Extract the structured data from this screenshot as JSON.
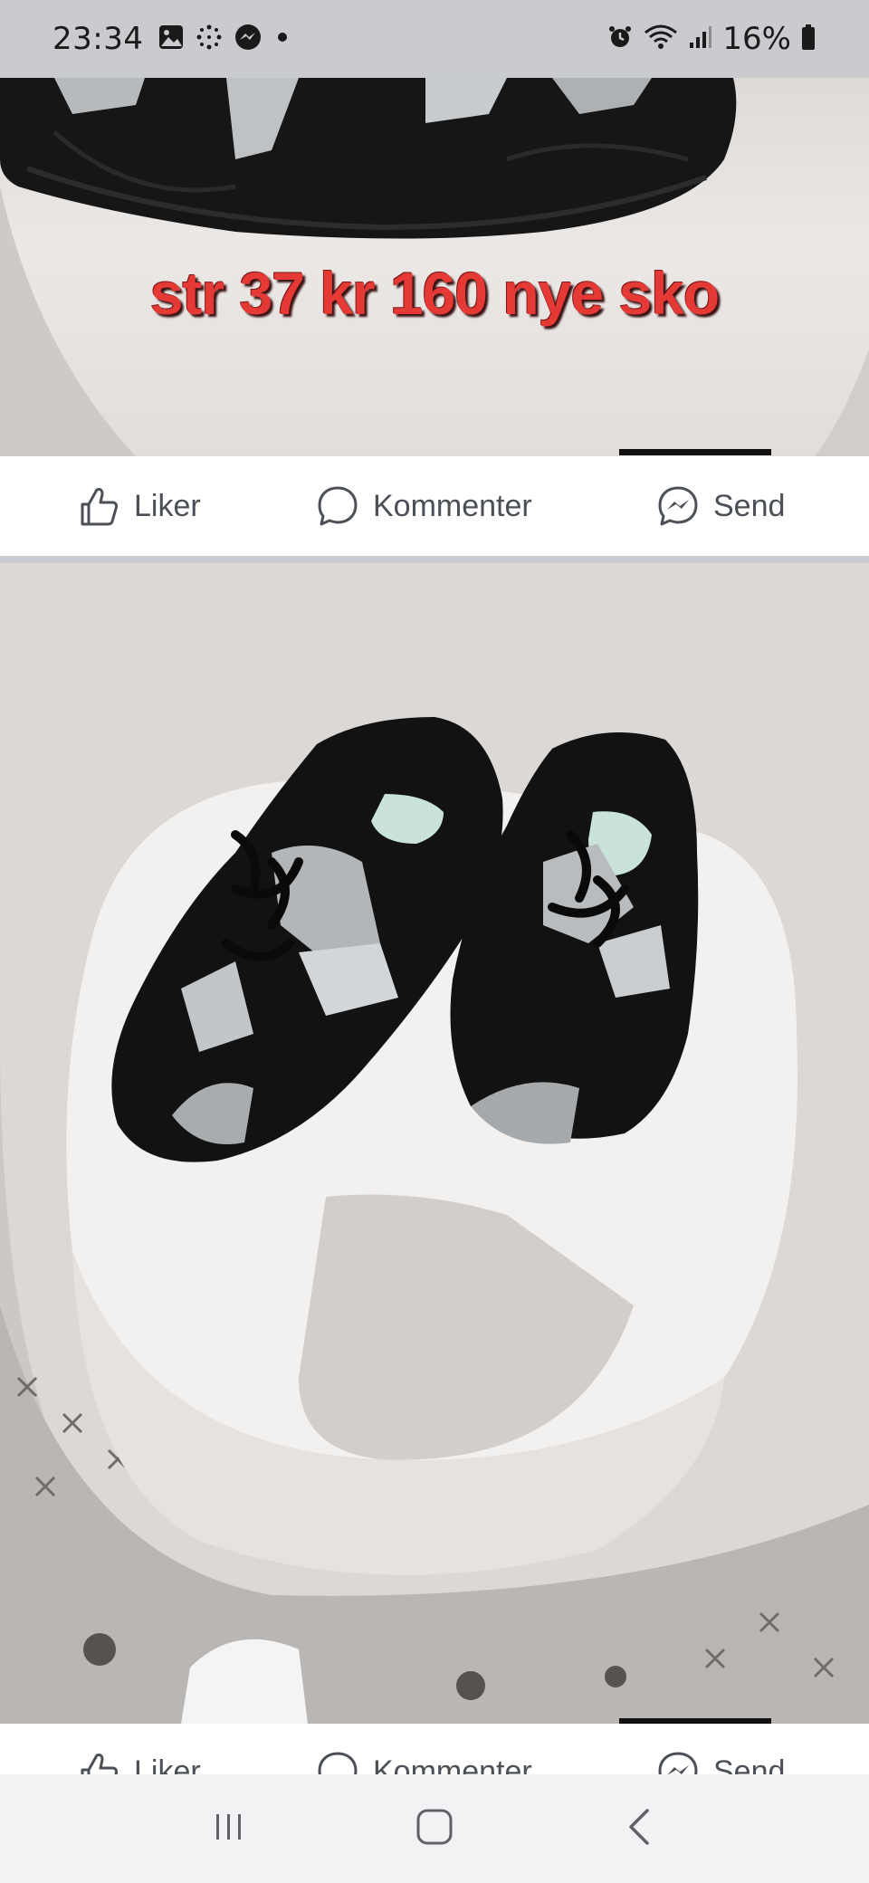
{
  "status_bar": {
    "time": "23:34",
    "battery": "16%",
    "left_icons": [
      "gallery-icon",
      "sparkle-icon",
      "messenger-icon",
      "dot-icon"
    ],
    "right_icons": [
      "alarm-icon",
      "wifi-icon",
      "signal-icon",
      "battery-icon"
    ]
  },
  "post": {
    "overlay_text": "str 37 kr 160 nye sko",
    "actions": {
      "like": "Liker",
      "comment": "Kommenter",
      "send": "Send"
    }
  },
  "next_post": {
    "actions": {
      "like": "Liker",
      "comment": "Kommenter",
      "send": "Send"
    }
  },
  "colors": {
    "overlay_text": "#e53935",
    "action_text": "#4b4f56",
    "status_bar": "#c9cbcf",
    "separator": "#c9ccd1"
  },
  "nav_bar": {
    "icons": [
      "recent-apps-icon",
      "home-icon",
      "back-icon"
    ]
  }
}
